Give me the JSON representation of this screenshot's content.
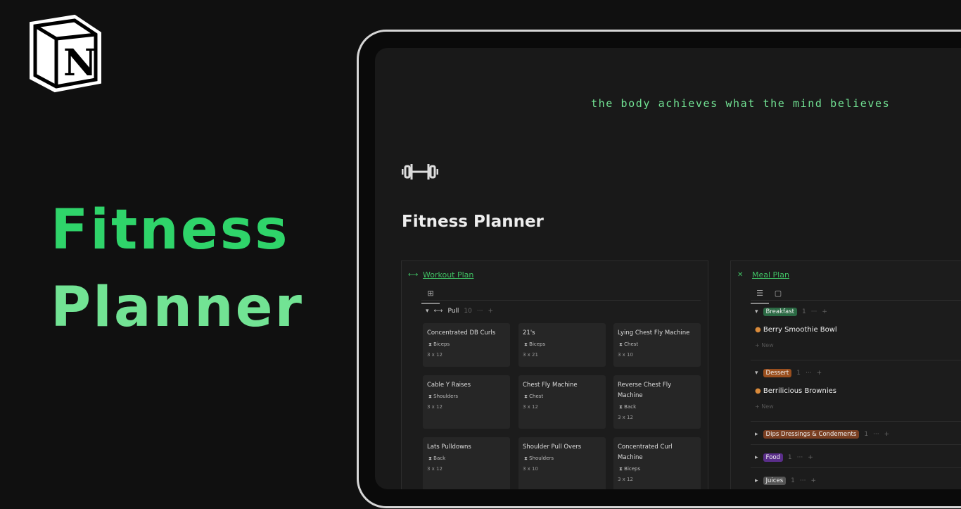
{
  "hero": {
    "line1": "Fitness",
    "line2": "Planner",
    "line1_color": "#2fd46a",
    "line2_color": "#72e394"
  },
  "logo": {
    "letter": "N",
    "name": "notion-logo"
  },
  "page": {
    "quote": "the body achieves what the mind believes",
    "title": "Fitness Planner",
    "icon": "dumbbell-icon"
  },
  "workout": {
    "title": "Workout Plan",
    "view_icon": "gallery-icon",
    "group": {
      "label": "Pull",
      "count": "10"
    },
    "cards": [
      {
        "name": "Concentrated DB Curls",
        "tag": "Biceps",
        "reps": "3 x 12"
      },
      {
        "name": "21's",
        "tag": "Biceps",
        "reps": "3 x 21"
      },
      {
        "name": "Lying Chest Fly Machine",
        "tag": "Chest",
        "reps": "3 x 10"
      },
      {
        "name": "Cable Y Raises",
        "tag": "Shoulders",
        "reps": "3 x 12"
      },
      {
        "name": "Chest Fly Machine",
        "tag": "Chest",
        "reps": "3 x 12"
      },
      {
        "name": "Reverse Chest Fly Machine",
        "tag": "Back",
        "reps": "3 x 12"
      },
      {
        "name": "Lats Pulldowns",
        "tag": "Back",
        "reps": "3 x 12"
      },
      {
        "name": "Shoulder Pull Overs",
        "tag": "Shoulders",
        "reps": "3 x 10"
      },
      {
        "name": "Concentrated Curl Machine",
        "tag": "Biceps",
        "reps": "3 x 12"
      }
    ]
  },
  "meal": {
    "title": "Meal Plan",
    "new_label": "New",
    "groups": [
      {
        "label": "Breakfast",
        "count": "1",
        "color": "#2b6a44",
        "item": "Berry Smoothie Bowl"
      },
      {
        "label": "Dessert",
        "count": "1",
        "color": "#9a4f1e",
        "item": "Berrilicious Brownies"
      },
      {
        "label": "Dips Dressings & Condements",
        "count": "1",
        "color": "#7a3f22"
      },
      {
        "label": "Food",
        "count": "1",
        "color": "#5a2e8a"
      },
      {
        "label": "Juices",
        "count": "1",
        "color": "#555555"
      }
    ]
  }
}
